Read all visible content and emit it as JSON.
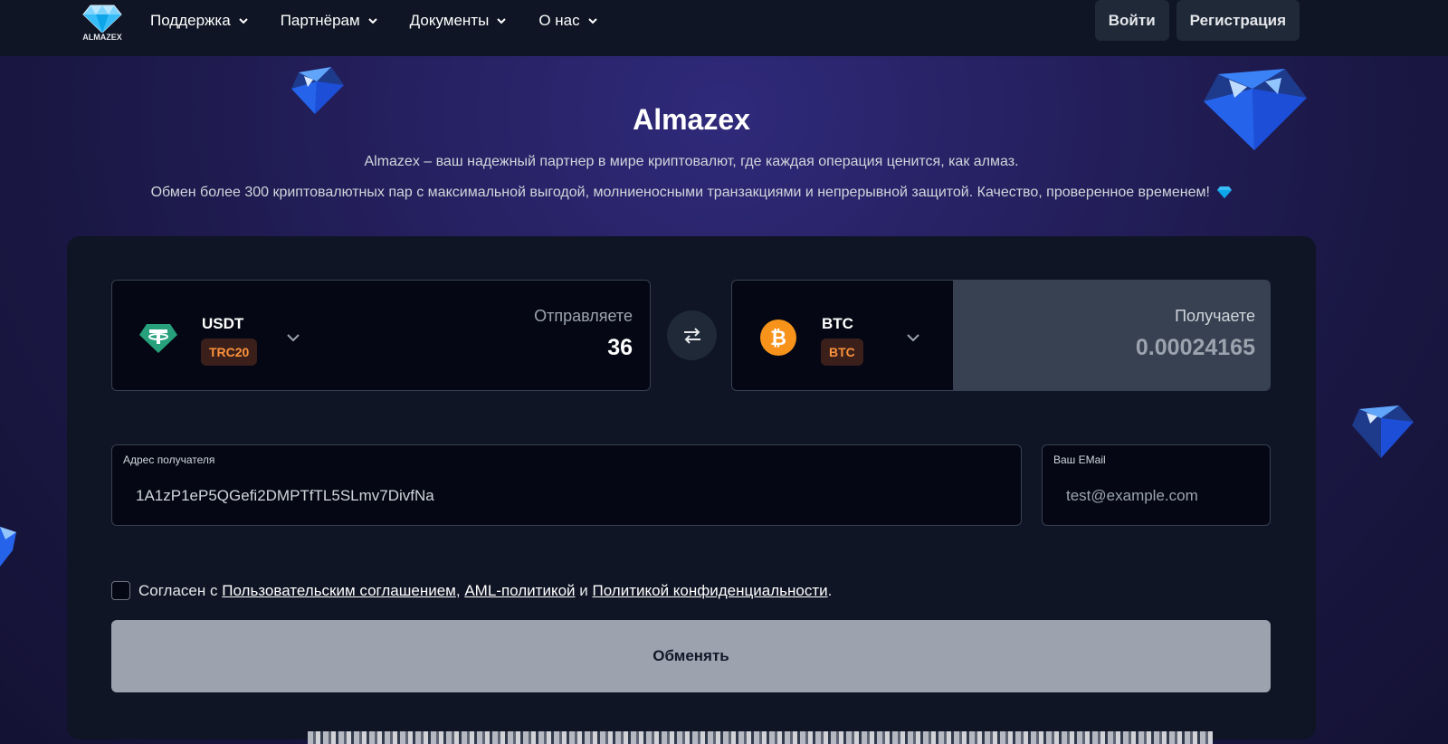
{
  "header": {
    "logo_text": "ALMAZEX",
    "nav": [
      {
        "label": "Поддержка"
      },
      {
        "label": "Партнёрам"
      },
      {
        "label": "Документы"
      },
      {
        "label": "О нас"
      }
    ],
    "login_label": "Войти",
    "register_label": "Регистрация"
  },
  "hero": {
    "title": "Almazex",
    "subtitle": "Almazex – ваш надежный партнер в мире криптовалют, где каждая операция ценится, как алмаз.",
    "description": "Обмен более 300 криптовалютных пар с максимальной выгодой, молниеносными транзакциями и непрерывной защитой. Качество, проверенное временем!"
  },
  "exchange": {
    "send": {
      "coin": "USDT",
      "network": "TRC20",
      "label": "Отправляете",
      "amount": "36",
      "icon": "tether-icon"
    },
    "receive": {
      "coin": "BTC",
      "network": "BTC",
      "label": "Получаете",
      "amount": "0.00024165",
      "icon": "bitcoin-icon"
    },
    "address": {
      "label": "Адрес получателя",
      "value": "1A1zP1eP5QGefi2DMPTfTL5SLmv7DivfNa"
    },
    "email": {
      "label": "Ваш EMail",
      "placeholder": "test@example.com"
    },
    "agreement": {
      "prefix": "Согласен с",
      "link1": "Пользовательским соглашением",
      "sep": ",",
      "link2": "AML-политикой",
      "and": "и",
      "link3": "Политикой конфиденциальности",
      "end": "."
    },
    "submit_label": "Обменять"
  },
  "colors": {
    "background": "#1a1744",
    "card": "#0f1524",
    "badge_text": "#fb923c",
    "tether": "#26a17b",
    "bitcoin": "#f7931a"
  }
}
